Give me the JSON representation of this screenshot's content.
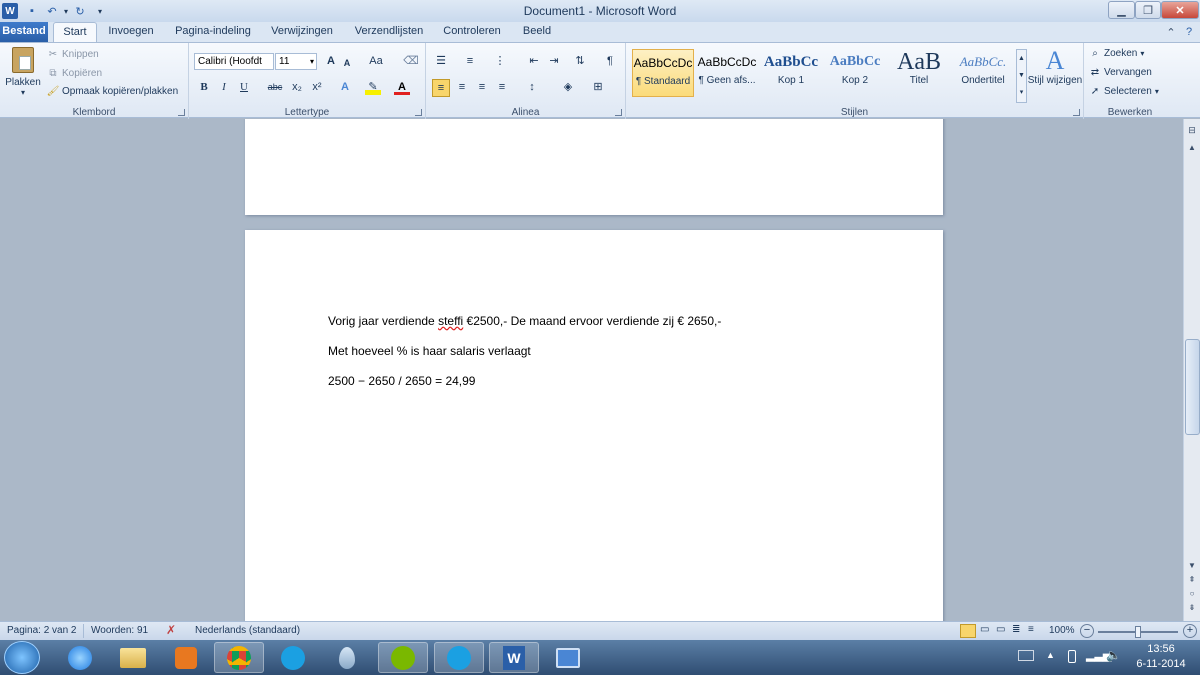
{
  "window": {
    "title": "Document1  -  Microsoft Word"
  },
  "quick_access": {
    "app_icon": "word-icon",
    "save": "save-icon",
    "undo": "undo-icon",
    "redo": "redo-icon"
  },
  "tabs": {
    "bestand": "Bestand",
    "items": [
      "Start",
      "Invoegen",
      "Pagina-indeling",
      "Verwijzingen",
      "Verzendlijsten",
      "Controleren",
      "Beeld"
    ]
  },
  "clipboard": {
    "paste": "Plakken",
    "cut": "Knippen",
    "copy": "Kopiëren",
    "format_painter": "Opmaak kopiëren/plakken",
    "label": "Klembord"
  },
  "font": {
    "name": "Calibri (Hoofdt",
    "size": "11",
    "label": "Lettertype",
    "bold": "B",
    "italic": "I",
    "underline": "U",
    "strike": "abc",
    "sub": "x₂",
    "sup": "x²",
    "grow": "A",
    "shrink": "A",
    "case": "Aa"
  },
  "paragraph": {
    "label": "Alinea",
    "pilcrow": "¶"
  },
  "styles": {
    "label": "Stijlen",
    "items": [
      {
        "preview": "AaBbCcDc",
        "name": "¶ Standaard",
        "selected": true
      },
      {
        "preview": "AaBbCcDc",
        "name": "¶ Geen afs..."
      },
      {
        "preview": "AaBbCc",
        "name": "Kop 1"
      },
      {
        "preview": "AaBbCc",
        "name": "Kop 2"
      },
      {
        "preview": "AaB",
        "name": "Titel"
      },
      {
        "preview": "AaBbCc.",
        "name": "Ondertitel"
      }
    ],
    "change": "Stijl wijzigen"
  },
  "editing": {
    "label": "Bewerken",
    "find": "Zoeken",
    "replace": "Vervangen",
    "select": "Selecteren"
  },
  "document": {
    "line1_before": "Vorig jaar verdiende ",
    "line1_err": "steffi",
    "line1_after": " €2500,- De maand ervoor verdiende zij € 2650,-",
    "line2": "Met hoeveel % is haar salaris verlaagt",
    "line3": "2500  − 2650  / 2650  = 24,99"
  },
  "status": {
    "page": "Pagina: 2 van 2",
    "words": "Woorden: 91",
    "language": "Nederlands (standaard)",
    "zoom": "100%",
    "zoom_percent": 100
  },
  "taskbar": {
    "apps": [
      "ie-icon",
      "explorer-icon",
      "media-icon",
      "chrome-icon",
      "skype-icon",
      "droplet-icon",
      "spotify-icon",
      "skype2-icon",
      "word-icon",
      "remote-icon"
    ],
    "time": "13:56",
    "date": "6-11-2014"
  },
  "colors": {
    "accent": "#2a5fa8",
    "ribbon": "#dfe8f4",
    "highlight": "#f8d56b"
  }
}
